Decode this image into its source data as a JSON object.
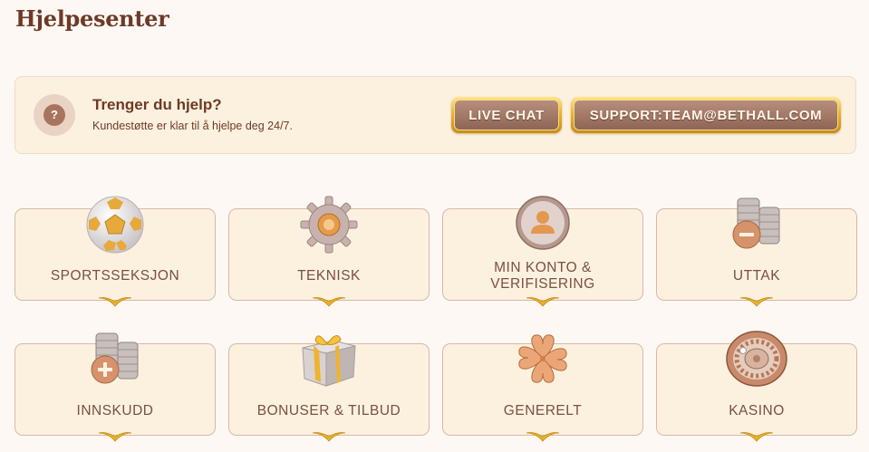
{
  "page": {
    "title": "Hjelpesenter"
  },
  "help": {
    "title": "Trenger du hjelp?",
    "subtitle": "Kundestøtte er klar til å hjelpe deg 24/7.",
    "icon_glyph": "?",
    "live_chat_label": "LIVE CHAT",
    "email_label": "SUPPORT:TEAM@BETHALL.COM"
  },
  "categories": [
    {
      "label": "SPORTSSEKSJON",
      "icon": "soccer-ball-icon"
    },
    {
      "label": "TEKNISK",
      "icon": "gear-icon"
    },
    {
      "label_line1": "MIN KONTO &",
      "label_line2": "VERIFISERING",
      "icon": "user-account-icon"
    },
    {
      "label": "UTTAK",
      "icon": "coin-stack-minus-icon"
    },
    {
      "label": "INNSKUDD",
      "icon": "coin-stack-plus-icon"
    },
    {
      "label": "BONUSER & TILBUD",
      "icon": "gift-box-icon"
    },
    {
      "label": "GENERELT",
      "icon": "clover-icon"
    },
    {
      "label": "KASINO",
      "icon": "roulette-wheel-icon"
    }
  ],
  "colors": {
    "background": "#fdf8f3",
    "panel": "#fcf1df",
    "text_brown": "#6e3a28",
    "gold": "#e9b530",
    "button_face": "#9c7362"
  }
}
